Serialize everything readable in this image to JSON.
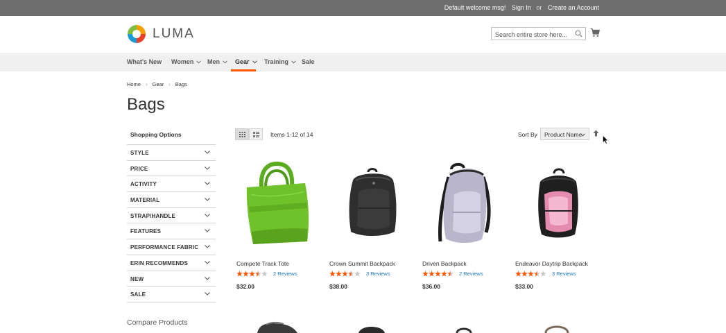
{
  "topbar": {
    "welcome": "Default welcome msg!",
    "sign_in": "Sign In",
    "or": "or",
    "create_account": "Create an Account"
  },
  "header": {
    "logo_text": "LUMA",
    "search_placeholder": "Search entire store here...",
    "icons": [
      "search-icon",
      "cart-icon"
    ]
  },
  "nav": {
    "items": [
      {
        "label": "What's New",
        "has_dropdown": false
      },
      {
        "label": "Women",
        "has_dropdown": true
      },
      {
        "label": "Men",
        "has_dropdown": true
      },
      {
        "label": "Gear",
        "has_dropdown": true,
        "active": true
      },
      {
        "label": "Training",
        "has_dropdown": true
      },
      {
        "label": "Sale",
        "has_dropdown": false
      }
    ],
    "active_color": "#ff5501"
  },
  "breadcrumb": [
    "Home",
    "Gear",
    "Bags"
  ],
  "page_title": "Bags",
  "sidebar": {
    "title": "Shopping Options",
    "filters": [
      "STYLE",
      "PRICE",
      "ACTIVITY",
      "MATERIAL",
      "STRAP/HANDLE",
      "FEATURES",
      "PERFORMANCE FABRIC",
      "ERIN RECOMMENDS",
      "NEW",
      "SALE"
    ],
    "compare_title": "Compare Products"
  },
  "toolbar": {
    "amount": "Items 1-12 of 14",
    "sort_label": "Sort By",
    "sort_value": "Product Name"
  },
  "products": [
    {
      "name": "Compete Track Tote",
      "rating": 3.5,
      "reviews": "2  Reviews",
      "price": "$32.00",
      "color": "#6fc22a"
    },
    {
      "name": "Crown Summit Backpack",
      "rating": 3.5,
      "reviews": "3  Reviews",
      "price": "$38.00",
      "color": "#2e2e2e"
    },
    {
      "name": "Driven Backpack",
      "rating": 4.5,
      "reviews": "2  Reviews",
      "price": "$36.00",
      "color": "#b9b6cc"
    },
    {
      "name": "Endeavor Daytrip Backpack",
      "rating": 3.5,
      "reviews": "3  Reviews",
      "price": "$33.00",
      "color": "#e58bb0"
    }
  ],
  "colors": {
    "star": "#ff5501",
    "link": "#1979c3",
    "topbar": "#6e6e6e",
    "nav_bg": "#f0f0f0"
  }
}
